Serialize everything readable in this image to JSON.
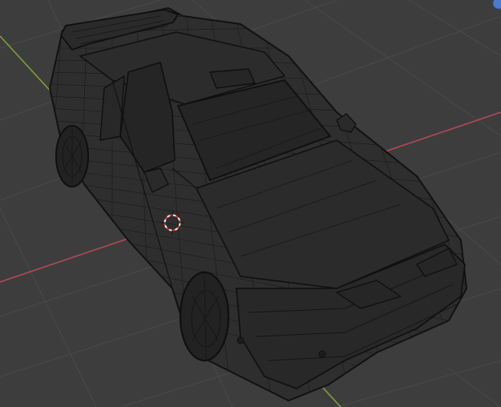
{
  "viewport": {
    "mode": "3d-viewport",
    "shading": "wireframe",
    "object": "rally-car-mesh",
    "colors": {
      "background": "#3d3d3d",
      "grid": "#4a4a4a",
      "x_axis": "#b34a56",
      "y_axis": "#7ea133",
      "wire": "#0f0f0f",
      "body_fill": "#2e2e2e",
      "cursor_red": "#d43a3a",
      "cursor_white": "#f2f2f2",
      "gizmo": "#4a7bd0"
    },
    "icons": {
      "cursor": "3d-cursor-icon",
      "gizmo": "navigation-gizmo-icon"
    }
  }
}
